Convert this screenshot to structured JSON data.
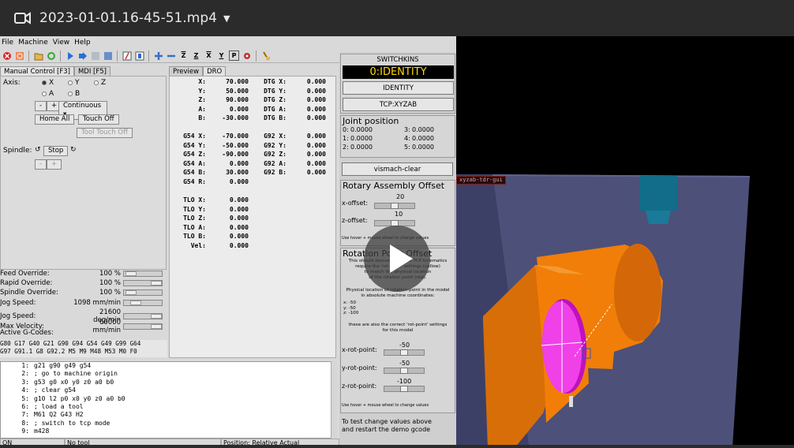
{
  "player": {
    "title": "2023-01-01.16-45-51.mp4",
    "camera_icon": "video-camera-icon",
    "caret_icon": "chevron-down-icon"
  },
  "menu": [
    "File",
    "Machine",
    "View",
    "Help"
  ],
  "toolbar_icons": [
    "estop-icon",
    "power-icon",
    "open-icon",
    "reload-icon",
    "run-icon",
    "step-icon",
    "pause-icon",
    "stop-icon",
    "block-delete-icon",
    "optional-stop-icon",
    "zoom-in-icon",
    "zoom-out-icon",
    "view-z-icon",
    "view-z2-icon",
    "view-x-icon",
    "view-y-icon",
    "view-p-icon",
    "rotate-icon",
    "clear-icon"
  ],
  "toolbar_letters": [
    "Z",
    "Z",
    "X",
    "Y",
    "P"
  ],
  "left_tabs": [
    "Manual Control [F3]",
    "MDI [F5]"
  ],
  "manual": {
    "axis_label": "Axis:",
    "axes": [
      "X",
      "Y",
      "Z",
      "A",
      "B"
    ],
    "selected_axis": "X",
    "minus": "-",
    "plus": "+",
    "jog_mode": "Continuous",
    "home_all": "Home All",
    "touch_off": "Touch Off",
    "tool_touch_off": "Tool Touch Off",
    "spindle_label": "Spindle:",
    "stop": "Stop",
    "spindle_minus": "-",
    "spindle_plus": "+"
  },
  "right_tabs": [
    "Preview",
    "DRO"
  ],
  "dro": {
    "pos": [
      [
        "X:",
        "70.000"
      ],
      [
        "Y:",
        "50.000"
      ],
      [
        "Z:",
        "90.000"
      ],
      [
        "A:",
        "0.000"
      ],
      [
        "B:",
        "-30.000"
      ]
    ],
    "dtg": [
      [
        "DTG X:",
        "0.000"
      ],
      [
        "DTG Y:",
        "0.000"
      ],
      [
        "DTG Z:",
        "0.000"
      ],
      [
        "DTG A:",
        "0.000"
      ],
      [
        "DTG B:",
        "0.000"
      ]
    ],
    "g54": [
      [
        "G54 X:",
        "-70.000"
      ],
      [
        "G54 Y:",
        "-50.000"
      ],
      [
        "G54 Z:",
        "-90.000"
      ],
      [
        "G54 A:",
        "0.000"
      ],
      [
        "G54 B:",
        "30.000"
      ],
      [
        "G54 R:",
        "0.000"
      ]
    ],
    "g92": [
      [
        "G92 X:",
        "0.000"
      ],
      [
        "G92 Y:",
        "0.000"
      ],
      [
        "G92 Z:",
        "0.000"
      ],
      [
        "G92 A:",
        "0.000"
      ],
      [
        "G92 B:",
        "0.000"
      ]
    ],
    "tlo": [
      [
        "TLO X:",
        "0.000"
      ],
      [
        "TLO Y:",
        "0.000"
      ],
      [
        "TLO Z:",
        "0.000"
      ],
      [
        "TLO A:",
        "0.000"
      ],
      [
        "TLO B:",
        "0.000"
      ],
      [
        "Vel:",
        "0.000"
      ]
    ]
  },
  "overrides": [
    {
      "label": "Feed Override:",
      "value": "100 %"
    },
    {
      "label": "Rapid Override:",
      "value": "100 %"
    },
    {
      "label": "Spindle Override:",
      "value": "100 %"
    },
    {
      "label": "Jog Speed:",
      "value": "1098 mm/min"
    },
    {
      "label": "Jog Speed:",
      "value": "21600 deg/min"
    },
    {
      "label": "Max Velocity:",
      "value": "60000 mm/min"
    }
  ],
  "active_gcodes_label": "Active G-Codes:",
  "active_gcodes": [
    "G80 G17 G40 G21 G90 G94 G54 G49 G99 G64",
    "G97 G91.1 G8 G92.2 M5 M9 M48 M53 M0 F0"
  ],
  "gcode_lines": [
    {
      "n": "1:",
      "t": "g21 g90 g49 g54"
    },
    {
      "n": "2:",
      "t": "; go to machine origin"
    },
    {
      "n": "3:",
      "t": "g53 g0 x0 y0 z0 a0 b0"
    },
    {
      "n": "4:",
      "t": "; clear g54"
    },
    {
      "n": "5:",
      "t": "g10 l2 p0 x0 y0 z0 a0 b0"
    },
    {
      "n": "6:",
      "t": "; load a tool"
    },
    {
      "n": "7:",
      "t": "M61 Q2 G43 H2"
    },
    {
      "n": "8:",
      "t": "; switch to tcp mode"
    },
    {
      "n": "9:",
      "t": "m428"
    }
  ],
  "status": [
    "ON",
    "No tool",
    "Position: Relative Actual"
  ],
  "switchkins": {
    "title": "SWITCHKINS",
    "display": "0:IDENTITY",
    "identity_btn": "IDENTITY",
    "tcp_btn": "TCP:XYZAB"
  },
  "joint": {
    "title": "Joint position",
    "rows": [
      [
        "0:",
        "0.0000",
        "3:",
        "0.0000"
      ],
      [
        "1:",
        "0.0000",
        "4:",
        "0.0000"
      ],
      [
        "2:",
        "0.0000",
        "5:",
        "0.0000"
      ]
    ]
  },
  "vismach_btn": "vismach-clear",
  "rotary": {
    "title": "Rotary Assembly Offset",
    "x_label": "x-offset:",
    "x_value": "20",
    "z_label": "z-offset:",
    "z_value": "10",
    "hint": "Use hover + mouse wheel to change values"
  },
  "rotpoint": {
    "title": "Rotation Point Offset",
    "desc": [
      "This should demonstrate the TCP kinematics",
      "require the 'rot-point' settings (yellow)",
      "to match the physical location",
      "of the rotation point (red)."
    ],
    "phys": [
      "Physical location of rotation-point in the model",
      "in absolute machine coordinates:"
    ],
    "coords": [
      "x: -50",
      "y: -50",
      "z: -100"
    ],
    "note": [
      "these are also the correct 'rot-point' settings",
      "for this model"
    ],
    "x_label": "x-rot-point:",
    "x_value": "-50",
    "y_label": "y-rot-point:",
    "y_value": "-50",
    "z_label": "z-rot-point:",
    "z_value": "-100",
    "hint": "Use hover + mouse wheel to change values"
  },
  "test_note": [
    "To test change values above",
    "and restart the demo gcode"
  ],
  "viewer_label": "xyzab-tdr-gui",
  "play_icon": "play-icon"
}
